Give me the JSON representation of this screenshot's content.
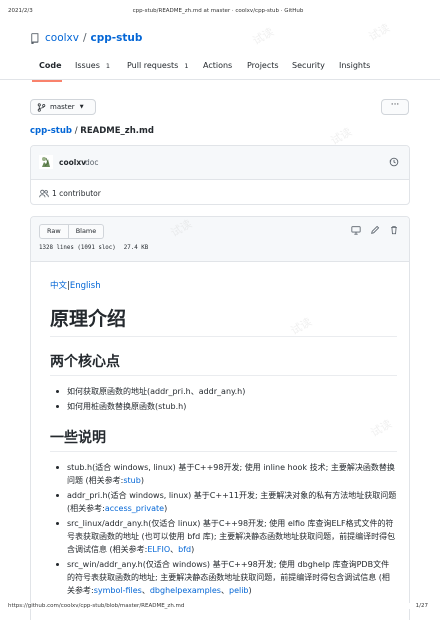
{
  "print_header": {
    "date": "2021/2/3",
    "title": "cpp-stub/README_zh.md at master · coolxv/cpp-stub · GitHub"
  },
  "repo": {
    "owner": "coolxv",
    "separator": "/",
    "name": "cpp-stub"
  },
  "tabs": [
    {
      "label": "Code",
      "count": ""
    },
    {
      "label": "Issues",
      "count": "1"
    },
    {
      "label": "Pull requests",
      "count": "1"
    },
    {
      "label": "Actions",
      "count": ""
    },
    {
      "label": "Projects",
      "count": ""
    },
    {
      "label": "Security",
      "count": ""
    },
    {
      "label": "Insights",
      "count": ""
    }
  ],
  "branch": {
    "label": "master"
  },
  "more_label": "···",
  "breadcrumb": {
    "root": "cpp-stub",
    "sep": " / ",
    "file": "README_zh.md"
  },
  "commit": {
    "author": "coolxv",
    "message": "doc"
  },
  "contributors": {
    "label": "1 contributor"
  },
  "file": {
    "raw_label": "Raw",
    "blame_label": "Blame",
    "lines": "1328 lines (1091 sloc)",
    "size": "27.4 KB"
  },
  "markdown": {
    "lang_cn": "中文",
    "lang_bar": "|",
    "lang_en": "English",
    "h1": "原理介绍",
    "h2_core": "两个核心点",
    "core_items": [
      {
        "pre": "如何获取原函数的地址(",
        "code": "addr_pri.h",
        "mid": "、",
        "code2": "addr_any.h",
        "post": ")"
      },
      {
        "pre": "如何用桩函数替换原函数(",
        "code": "stub.h",
        "mid": "",
        "code2": "",
        "post": ")"
      }
    ],
    "h2_notes": "一些说明",
    "notes": [
      {
        "text": "stub.h(适合 windows, linux) 基于C++98开发; 使用 inline hook 技术; 主要解决函数替换问题 (相关参考:",
        "link1": "stub",
        "sep": "",
        "link2": "",
        "end": ")"
      },
      {
        "text": "addr_pri.h(适合 windows, linux) 基于C++11开发; 主要解决对象的私有方法地址获取问题 (相关参考:",
        "link1": "access_private",
        "sep": "",
        "link2": "",
        "end": ")"
      },
      {
        "text": "src_linux/addr_any.h(仅适合 linux) 基于C++98开发; 使用 elfio 库查询ELF格式文件的符号表获取函数的地址 (也可以使用 bfd 库); 主要解决静态函数地址获取问题，前提编译时得包含调试信息 (相关参考:",
        "link1": "ELFIO",
        "sep": "、",
        "link2": "bfd",
        "end": ")"
      },
      {
        "text": "src_win/addr_any.h(仅适合 windows) 基于C++98开发; 使用 dbghelp 库查询PDB文件的符号表获取函数的地址; 主要解决静态函数地址获取问题，前提编译时得包含调试信息 (相关参考:",
        "link1": "symbol-files",
        "sep": "、",
        "link2": "dbghelpexamples",
        "sep2": "、",
        "link3": "pelib",
        "end": ")"
      }
    ]
  },
  "print_footer": {
    "url": "https://github.com/coolxv/cpp-stub/blob/master/README_zh.md",
    "page": "1/27"
  },
  "watermark_text": "试读",
  "colors": {
    "link": "#0366d6",
    "tab_underline": "#f9826c",
    "text": "#24292e"
  }
}
